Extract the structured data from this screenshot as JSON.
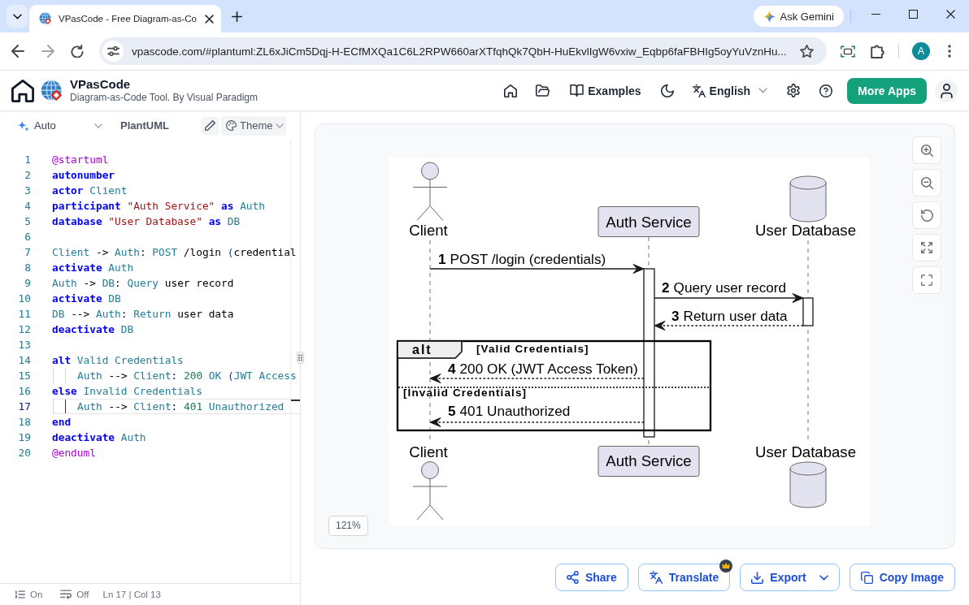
{
  "browser": {
    "tabs": [
      {
        "title": "VPasCode - Free Diagram-as-Co",
        "selected": true
      }
    ],
    "gemini_button": "Ask Gemini",
    "address": "vpascode.com/#plantuml:ZL6xJiCm5Dqj-H-ECfMXQa1C6L2RPW660arXTfqhQk7QbH-HuEkvlIgW6vxiw_Eqbp6faFBHIg5oyYuVznHu...",
    "profile_initial": "A"
  },
  "header": {
    "app_name": "VPasCode",
    "tagline": "Diagram-as-Code Tool. By Visual Paradigm",
    "examples": "Examples",
    "language": "English",
    "more_apps": "More Apps"
  },
  "editor": {
    "toolbar": {
      "mode": "Auto",
      "syntax": "PlantUML",
      "theme": "Theme"
    },
    "lines": [
      {
        "number": "1",
        "current": false,
        "indented": false,
        "tokens": [
          {
            "kind": "directive",
            "text": "@startuml"
          }
        ]
      },
      {
        "number": "2",
        "current": false,
        "indented": false,
        "tokens": [
          {
            "kind": "keyword",
            "text": "autonumber"
          }
        ]
      },
      {
        "number": "3",
        "current": false,
        "indented": false,
        "tokens": [
          {
            "kind": "keyword",
            "text": "actor"
          },
          {
            "kind": "name",
            "text": " Client"
          }
        ]
      },
      {
        "number": "4",
        "current": false,
        "indented": false,
        "tokens": [
          {
            "kind": "keyword",
            "text": "participant"
          },
          {
            "kind": "string",
            "text": " \"Auth Service\""
          },
          {
            "kind": "keyword",
            "text": " as"
          },
          {
            "kind": "name",
            "text": " Auth"
          }
        ]
      },
      {
        "number": "5",
        "current": false,
        "indented": false,
        "tokens": [
          {
            "kind": "keyword",
            "text": "database"
          },
          {
            "kind": "string",
            "text": " \"User Database\""
          },
          {
            "kind": "keyword",
            "text": " as"
          },
          {
            "kind": "name",
            "text": " DB"
          }
        ]
      },
      {
        "number": "6",
        "current": false,
        "indented": false
      },
      {
        "number": "7",
        "current": false,
        "indented": false,
        "tokens": [
          {
            "kind": "name",
            "text": "Client"
          },
          {
            "kind": "plain",
            "text": " -> "
          },
          {
            "kind": "name",
            "text": "Auth"
          },
          {
            "kind": "plain",
            "text": ": "
          },
          {
            "kind": "name",
            "text": "POST"
          },
          {
            "kind": "plain",
            "text": " /login "
          },
          {
            "kind": "paren",
            "text": "("
          },
          {
            "kind": "plain",
            "text": "credential"
          }
        ]
      },
      {
        "number": "8",
        "current": false,
        "indented": false,
        "tokens": [
          {
            "kind": "keyword",
            "text": "activate"
          },
          {
            "kind": "name",
            "text": " Auth"
          }
        ]
      },
      {
        "number": "9",
        "current": false,
        "indented": false,
        "tokens": [
          {
            "kind": "name",
            "text": "Auth"
          },
          {
            "kind": "plain",
            "text": " -> "
          },
          {
            "kind": "name",
            "text": "DB"
          },
          {
            "kind": "plain",
            "text": ": "
          },
          {
            "kind": "name",
            "text": "Query"
          },
          {
            "kind": "plain",
            "text": " user record"
          }
        ]
      },
      {
        "number": "10",
        "current": false,
        "indented": false,
        "tokens": [
          {
            "kind": "keyword",
            "text": "activate"
          },
          {
            "kind": "name",
            "text": " DB"
          }
        ]
      },
      {
        "number": "11",
        "current": false,
        "indented": false,
        "tokens": [
          {
            "kind": "name",
            "text": "DB"
          },
          {
            "kind": "plain",
            "text": " --> "
          },
          {
            "kind": "name",
            "text": "Auth"
          },
          {
            "kind": "plain",
            "text": ": "
          },
          {
            "kind": "name",
            "text": "Return"
          },
          {
            "kind": "plain",
            "text": " user data"
          }
        ]
      },
      {
        "number": "12",
        "current": false,
        "indented": false,
        "tokens": [
          {
            "kind": "keyword",
            "text": "deactivate"
          },
          {
            "kind": "name",
            "text": " DB"
          }
        ]
      },
      {
        "number": "13",
        "current": false,
        "indented": false
      },
      {
        "number": "14",
        "current": false,
        "indented": false,
        "tokens": [
          {
            "kind": "keyword",
            "text": "alt"
          },
          {
            "kind": "name",
            "text": " Valid Credentials"
          }
        ]
      },
      {
        "number": "15",
        "current": false,
        "indented": true,
        "tokens": [
          {
            "kind": "name",
            "text": "Auth"
          },
          {
            "kind": "plain",
            "text": " --> "
          },
          {
            "kind": "name",
            "text": "Client"
          },
          {
            "kind": "plain",
            "text": ": "
          },
          {
            "kind": "number",
            "text": "200"
          },
          {
            "kind": "name",
            "text": " OK "
          },
          {
            "kind": "paren",
            "text": "("
          },
          {
            "kind": "name",
            "text": "JWT Access"
          }
        ]
      },
      {
        "number": "16",
        "current": false,
        "indented": false,
        "tokens": [
          {
            "kind": "keyword",
            "text": "else"
          },
          {
            "kind": "name",
            "text": " Invalid Credentials"
          }
        ]
      },
      {
        "number": "17",
        "current": true,
        "indented": true,
        "tokens": [
          {
            "kind": "name",
            "text": "Auth"
          },
          {
            "kind": "plain",
            "text": " --> "
          },
          {
            "kind": "name",
            "text": "Client"
          },
          {
            "kind": "plain",
            "text": ": "
          },
          {
            "kind": "number",
            "text": "401"
          },
          {
            "kind": "name",
            "text": " Unauthorized"
          }
        ]
      },
      {
        "number": "18",
        "current": false,
        "indented": false,
        "tokens": [
          {
            "kind": "keyword",
            "text": "end"
          }
        ]
      },
      {
        "number": "19",
        "current": false,
        "indented": false,
        "tokens": [
          {
            "kind": "keyword",
            "text": "deactivate"
          },
          {
            "kind": "name",
            "text": " Auth"
          }
        ]
      },
      {
        "number": "20",
        "current": false,
        "indented": false,
        "tokens": [
          {
            "kind": "directive",
            "text": "@enduml"
          }
        ]
      }
    ],
    "status_bar": {
      "line_numbers": "On",
      "word_wrap": "Off",
      "cursor": "Ln 17 | Col 13"
    }
  },
  "preview": {
    "diagram": {
      "participants": [
        {
          "kind": "actor",
          "head_label": "Client",
          "foot_label": "Client"
        },
        {
          "kind": "participant",
          "head_label": "Auth Service",
          "foot_label": "Auth Service"
        },
        {
          "kind": "database",
          "head_label": "User Database",
          "foot_label": "User Database"
        }
      ],
      "messages": [
        {
          "number": "1",
          "text": "POST /login (credentials)",
          "kind": "call"
        },
        {
          "number": "2",
          "text": "Query user record",
          "kind": "call"
        },
        {
          "number": "3",
          "text": "Return user data",
          "kind": "return"
        },
        {
          "number": "4",
          "text": "200 OK (JWT Access Token)",
          "kind": "return"
        },
        {
          "number": "5",
          "text": "401 Unauthorized",
          "kind": "return"
        }
      ],
      "fragment": {
        "operator": "alt",
        "conditions": [
          "[Valid Credentials]",
          "[Invalid Credentials]"
        ]
      }
    },
    "zoom": "121%"
  },
  "actions": [
    {
      "kind": "share",
      "label": "Share",
      "premium": false,
      "menu": false
    },
    {
      "kind": "translate",
      "label": "Translate",
      "premium": true,
      "menu": false
    },
    {
      "kind": "export",
      "label": "Export",
      "premium": false,
      "menu": true
    },
    {
      "kind": "copy",
      "label": "Copy Image",
      "premium": false,
      "menu": false
    }
  ]
}
